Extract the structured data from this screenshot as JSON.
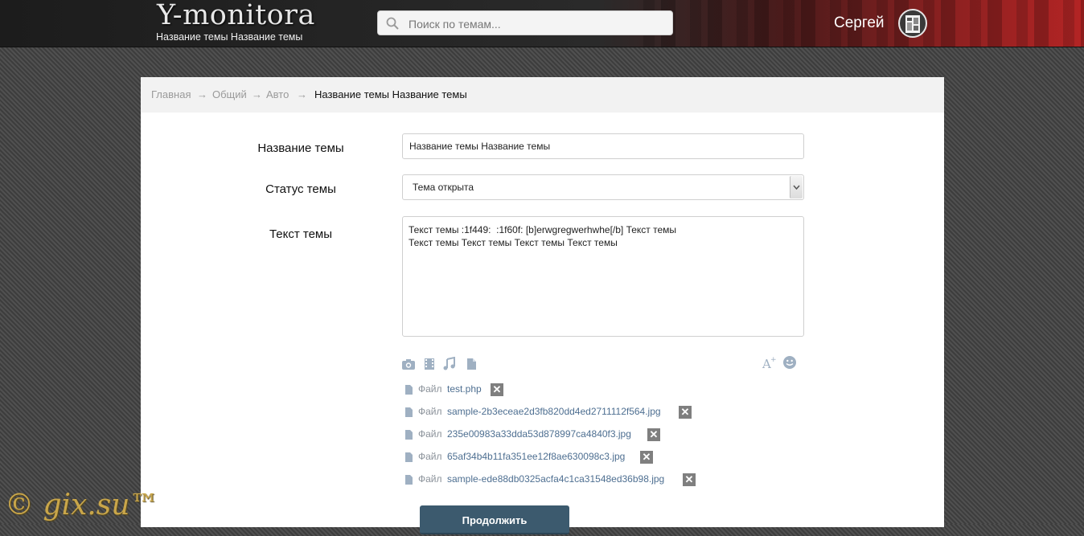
{
  "header": {
    "logo_title": "Y-monitora",
    "logo_subtitle": "Название темы Название темы",
    "search_placeholder": "Поиск по темам...",
    "username": "Сергей"
  },
  "breadcrumb": {
    "items": [
      "Главная",
      "Общий",
      "Авто"
    ],
    "separator": "→",
    "current": "Название темы Название темы"
  },
  "form": {
    "title_label": "Название темы",
    "title_value": "Название темы Название темы",
    "status_label": "Статус темы",
    "status_value": "Тема открыта",
    "text_label": "Текст темы",
    "text_value": "Текст темы :1f449:  :1f60f: [b]erwgregwerhwhe[/b] Текст темы\nТекст темы Текст темы Текст темы Текст темы"
  },
  "toolbar": {
    "left_icons": [
      "camera-icon",
      "film-icon",
      "music-icon",
      "document-icon"
    ],
    "right_icons": [
      "font-size-icon",
      "smiley-icon"
    ]
  },
  "files": {
    "prefix": "Файл",
    "items": [
      "test.php",
      "sample-2b3eceae2d3fb820dd4ed2711112f564.jpg",
      "235e00983a33dda53d878997ca4840f3.jpg",
      "65af34b4b11fa351ee12f8ae630098c3.jpg",
      "sample-ede88db0325acfa4c1ca31548ed36b98.jpg"
    ],
    "remove_symbol": "✕"
  },
  "buttons": {
    "continue": "Продолжить"
  },
  "watermark": "© gix.su™",
  "colors": {
    "accent_button": "#3c5a6e",
    "link": "#4e6f91",
    "header_red": "#b32424"
  }
}
